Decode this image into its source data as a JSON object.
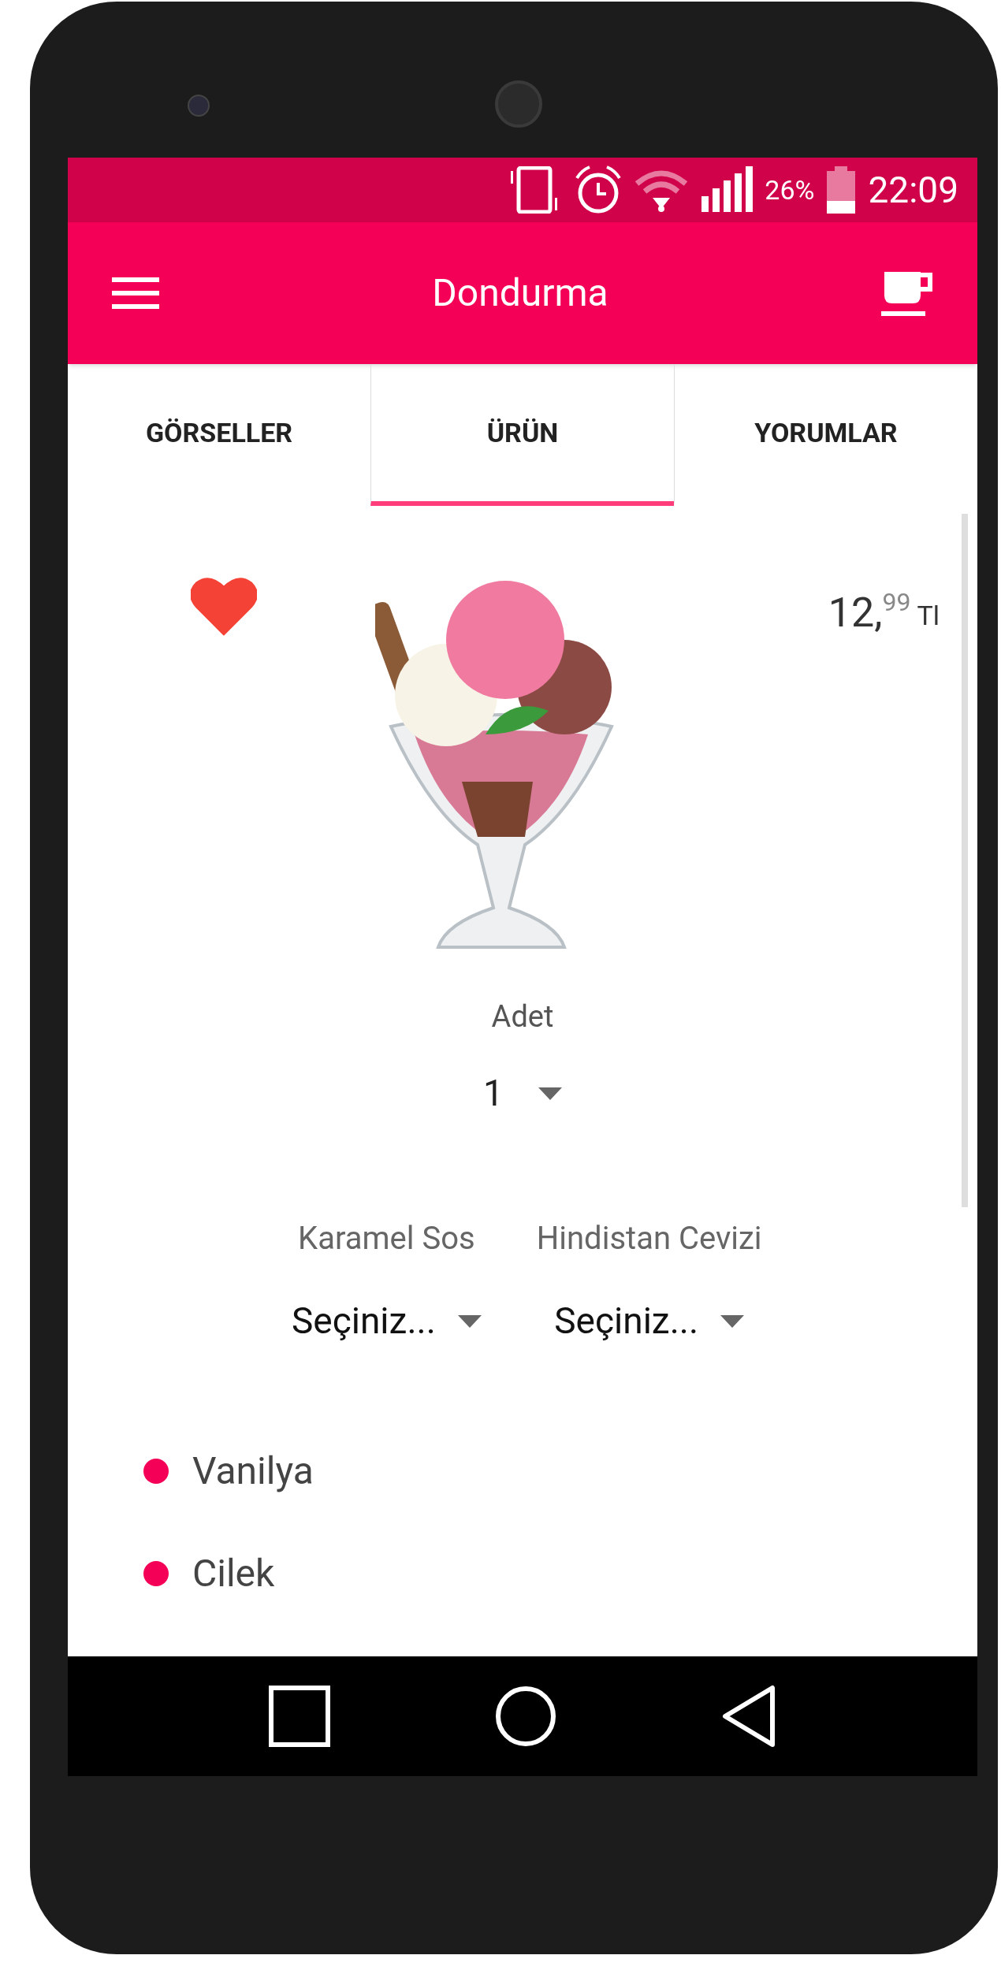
{
  "status_bar": {
    "battery": "26%",
    "time": "22:09"
  },
  "app_bar": {
    "title": "Dondurma"
  },
  "tabs": [
    {
      "label": "GÖRSELLER",
      "selected": false
    },
    {
      "label": "ÜRÜN",
      "selected": true
    },
    {
      "label": "YORUMLAR",
      "selected": false
    }
  ],
  "product": {
    "favorite": true,
    "price_main": "12,",
    "price_fraction": "99",
    "currency": "Tl"
  },
  "quantity": {
    "label": "Adet",
    "value": "1"
  },
  "options": [
    {
      "label": "Karamel Sos",
      "value": "Seçiniz..."
    },
    {
      "label": "Hindistan Cevizi",
      "value": "Seçiniz..."
    }
  ],
  "ingredients": [
    {
      "name": "Vanilya"
    },
    {
      "name": "Cilek"
    }
  ]
}
